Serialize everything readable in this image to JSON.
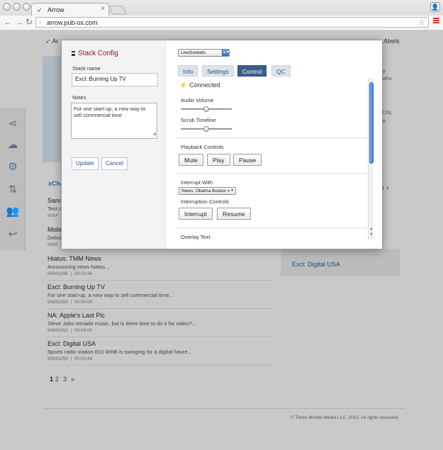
{
  "browser": {
    "tab_title": "Arrow",
    "url": "arrow.pub-os.com"
  },
  "page": {
    "brand_text": "Ar",
    "user_name_partial": "Abels",
    "side_texts": [
      "e",
      "who",
      "City,",
      "e"
    ],
    "list_header_partial": "xCha",
    "right_panel_link": "Excl: Digital USA",
    "pager": [
      "1",
      "2",
      "3",
      "»"
    ],
    "copyright": "© Three Minute Media LLC, 2015. All rights reserved.",
    "items": [
      {
        "title": "Sand",
        "desc": "Test c",
        "meta": "9084"
      },
      {
        "title": "Mobi",
        "desc": "Delive",
        "meta": "9084"
      },
      {
        "title": "Hiatus: TMM News",
        "desc": "Announcing news hiatus...",
        "id": "90843296",
        "time": "00:03:46"
      },
      {
        "title": "Excl: Burning Up TV",
        "desc": "For one start-up, a new way to sell commercial time...",
        "id": "90843263",
        "time": "00:04:08"
      },
      {
        "title": "NA: Apple's Last Pic",
        "desc": "Steve Jobs remade music, but is there time to do it for video?...",
        "id": "90843262",
        "time": "00:04:00"
      },
      {
        "title": "Excl: Digital USA",
        "desc": "Sports radio station 810 WHB is swinging for a digital future...",
        "id": "90843259",
        "time": "00:03:46"
      }
    ]
  },
  "modal": {
    "title": "Stack Config",
    "stack_name_label": "Stack name",
    "stack_name_value": "Excl: Burning Up TV",
    "notes_label": "Notes",
    "notes_value": "For one start-up, a new way to sell commercial time",
    "update_label": "Update",
    "cancel_label": "Cancel",
    "socket_select": "LiveSockets",
    "tabs": [
      "Info",
      "Settings",
      "Control",
      "QC"
    ],
    "active_tab": "Control",
    "status": "Connected",
    "audio_volume_label": "Audio Volume",
    "scrub_timeline_label": "Scrub Timeline",
    "audio_volume_level": 0.5,
    "scrub_timeline_level": 0.5,
    "playback_label": "Playback Controls",
    "mute_label": "Mute",
    "play_label": "Play",
    "pause_label": "Pause",
    "interrupt_with_label": "Interrupt With",
    "interrupt_select": "News: Obama Boston",
    "interruption_controls_label": "Interruption Controls",
    "interrupt_label": "Interrupt",
    "resume_label": "Resume",
    "overlay_text_label": "Overlay Text"
  },
  "colors": {
    "accent": "#3a5e8c",
    "title_red": "#8b1818",
    "link_blue": "#2c4e88"
  }
}
